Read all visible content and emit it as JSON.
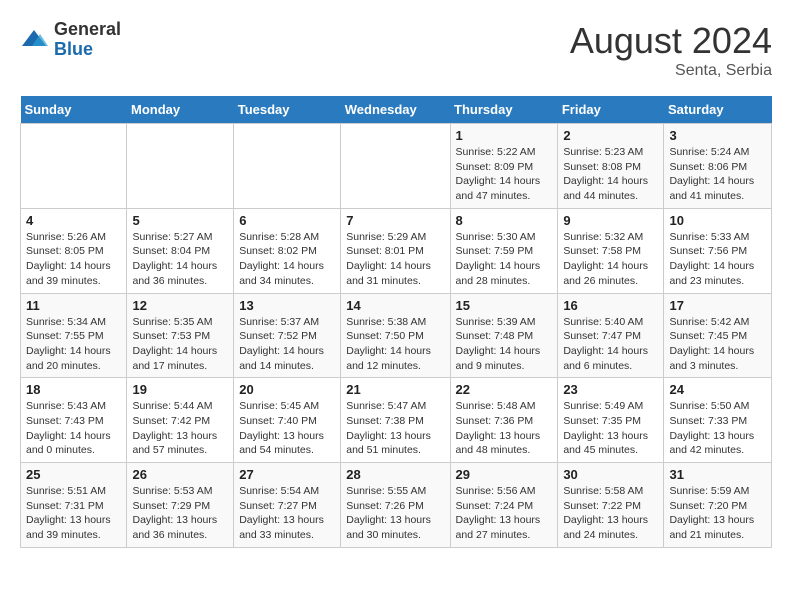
{
  "logo": {
    "general": "General",
    "blue": "Blue"
  },
  "title": {
    "month_year": "August 2024",
    "location": "Senta, Serbia"
  },
  "days_of_week": [
    "Sunday",
    "Monday",
    "Tuesday",
    "Wednesday",
    "Thursday",
    "Friday",
    "Saturday"
  ],
  "weeks": [
    [
      {
        "day": "",
        "info": ""
      },
      {
        "day": "",
        "info": ""
      },
      {
        "day": "",
        "info": ""
      },
      {
        "day": "",
        "info": ""
      },
      {
        "day": "1",
        "info": "Sunrise: 5:22 AM\nSunset: 8:09 PM\nDaylight: 14 hours and 47 minutes."
      },
      {
        "day": "2",
        "info": "Sunrise: 5:23 AM\nSunset: 8:08 PM\nDaylight: 14 hours and 44 minutes."
      },
      {
        "day": "3",
        "info": "Sunrise: 5:24 AM\nSunset: 8:06 PM\nDaylight: 14 hours and 41 minutes."
      }
    ],
    [
      {
        "day": "4",
        "info": "Sunrise: 5:26 AM\nSunset: 8:05 PM\nDaylight: 14 hours and 39 minutes."
      },
      {
        "day": "5",
        "info": "Sunrise: 5:27 AM\nSunset: 8:04 PM\nDaylight: 14 hours and 36 minutes."
      },
      {
        "day": "6",
        "info": "Sunrise: 5:28 AM\nSunset: 8:02 PM\nDaylight: 14 hours and 34 minutes."
      },
      {
        "day": "7",
        "info": "Sunrise: 5:29 AM\nSunset: 8:01 PM\nDaylight: 14 hours and 31 minutes."
      },
      {
        "day": "8",
        "info": "Sunrise: 5:30 AM\nSunset: 7:59 PM\nDaylight: 14 hours and 28 minutes."
      },
      {
        "day": "9",
        "info": "Sunrise: 5:32 AM\nSunset: 7:58 PM\nDaylight: 14 hours and 26 minutes."
      },
      {
        "day": "10",
        "info": "Sunrise: 5:33 AM\nSunset: 7:56 PM\nDaylight: 14 hours and 23 minutes."
      }
    ],
    [
      {
        "day": "11",
        "info": "Sunrise: 5:34 AM\nSunset: 7:55 PM\nDaylight: 14 hours and 20 minutes."
      },
      {
        "day": "12",
        "info": "Sunrise: 5:35 AM\nSunset: 7:53 PM\nDaylight: 14 hours and 17 minutes."
      },
      {
        "day": "13",
        "info": "Sunrise: 5:37 AM\nSunset: 7:52 PM\nDaylight: 14 hours and 14 minutes."
      },
      {
        "day": "14",
        "info": "Sunrise: 5:38 AM\nSunset: 7:50 PM\nDaylight: 14 hours and 12 minutes."
      },
      {
        "day": "15",
        "info": "Sunrise: 5:39 AM\nSunset: 7:48 PM\nDaylight: 14 hours and 9 minutes."
      },
      {
        "day": "16",
        "info": "Sunrise: 5:40 AM\nSunset: 7:47 PM\nDaylight: 14 hours and 6 minutes."
      },
      {
        "day": "17",
        "info": "Sunrise: 5:42 AM\nSunset: 7:45 PM\nDaylight: 14 hours and 3 minutes."
      }
    ],
    [
      {
        "day": "18",
        "info": "Sunrise: 5:43 AM\nSunset: 7:43 PM\nDaylight: 14 hours and 0 minutes."
      },
      {
        "day": "19",
        "info": "Sunrise: 5:44 AM\nSunset: 7:42 PM\nDaylight: 13 hours and 57 minutes."
      },
      {
        "day": "20",
        "info": "Sunrise: 5:45 AM\nSunset: 7:40 PM\nDaylight: 13 hours and 54 minutes."
      },
      {
        "day": "21",
        "info": "Sunrise: 5:47 AM\nSunset: 7:38 PM\nDaylight: 13 hours and 51 minutes."
      },
      {
        "day": "22",
        "info": "Sunrise: 5:48 AM\nSunset: 7:36 PM\nDaylight: 13 hours and 48 minutes."
      },
      {
        "day": "23",
        "info": "Sunrise: 5:49 AM\nSunset: 7:35 PM\nDaylight: 13 hours and 45 minutes."
      },
      {
        "day": "24",
        "info": "Sunrise: 5:50 AM\nSunset: 7:33 PM\nDaylight: 13 hours and 42 minutes."
      }
    ],
    [
      {
        "day": "25",
        "info": "Sunrise: 5:51 AM\nSunset: 7:31 PM\nDaylight: 13 hours and 39 minutes."
      },
      {
        "day": "26",
        "info": "Sunrise: 5:53 AM\nSunset: 7:29 PM\nDaylight: 13 hours and 36 minutes."
      },
      {
        "day": "27",
        "info": "Sunrise: 5:54 AM\nSunset: 7:27 PM\nDaylight: 13 hours and 33 minutes."
      },
      {
        "day": "28",
        "info": "Sunrise: 5:55 AM\nSunset: 7:26 PM\nDaylight: 13 hours and 30 minutes."
      },
      {
        "day": "29",
        "info": "Sunrise: 5:56 AM\nSunset: 7:24 PM\nDaylight: 13 hours and 27 minutes."
      },
      {
        "day": "30",
        "info": "Sunrise: 5:58 AM\nSunset: 7:22 PM\nDaylight: 13 hours and 24 minutes."
      },
      {
        "day": "31",
        "info": "Sunrise: 5:59 AM\nSunset: 7:20 PM\nDaylight: 13 hours and 21 minutes."
      }
    ]
  ]
}
